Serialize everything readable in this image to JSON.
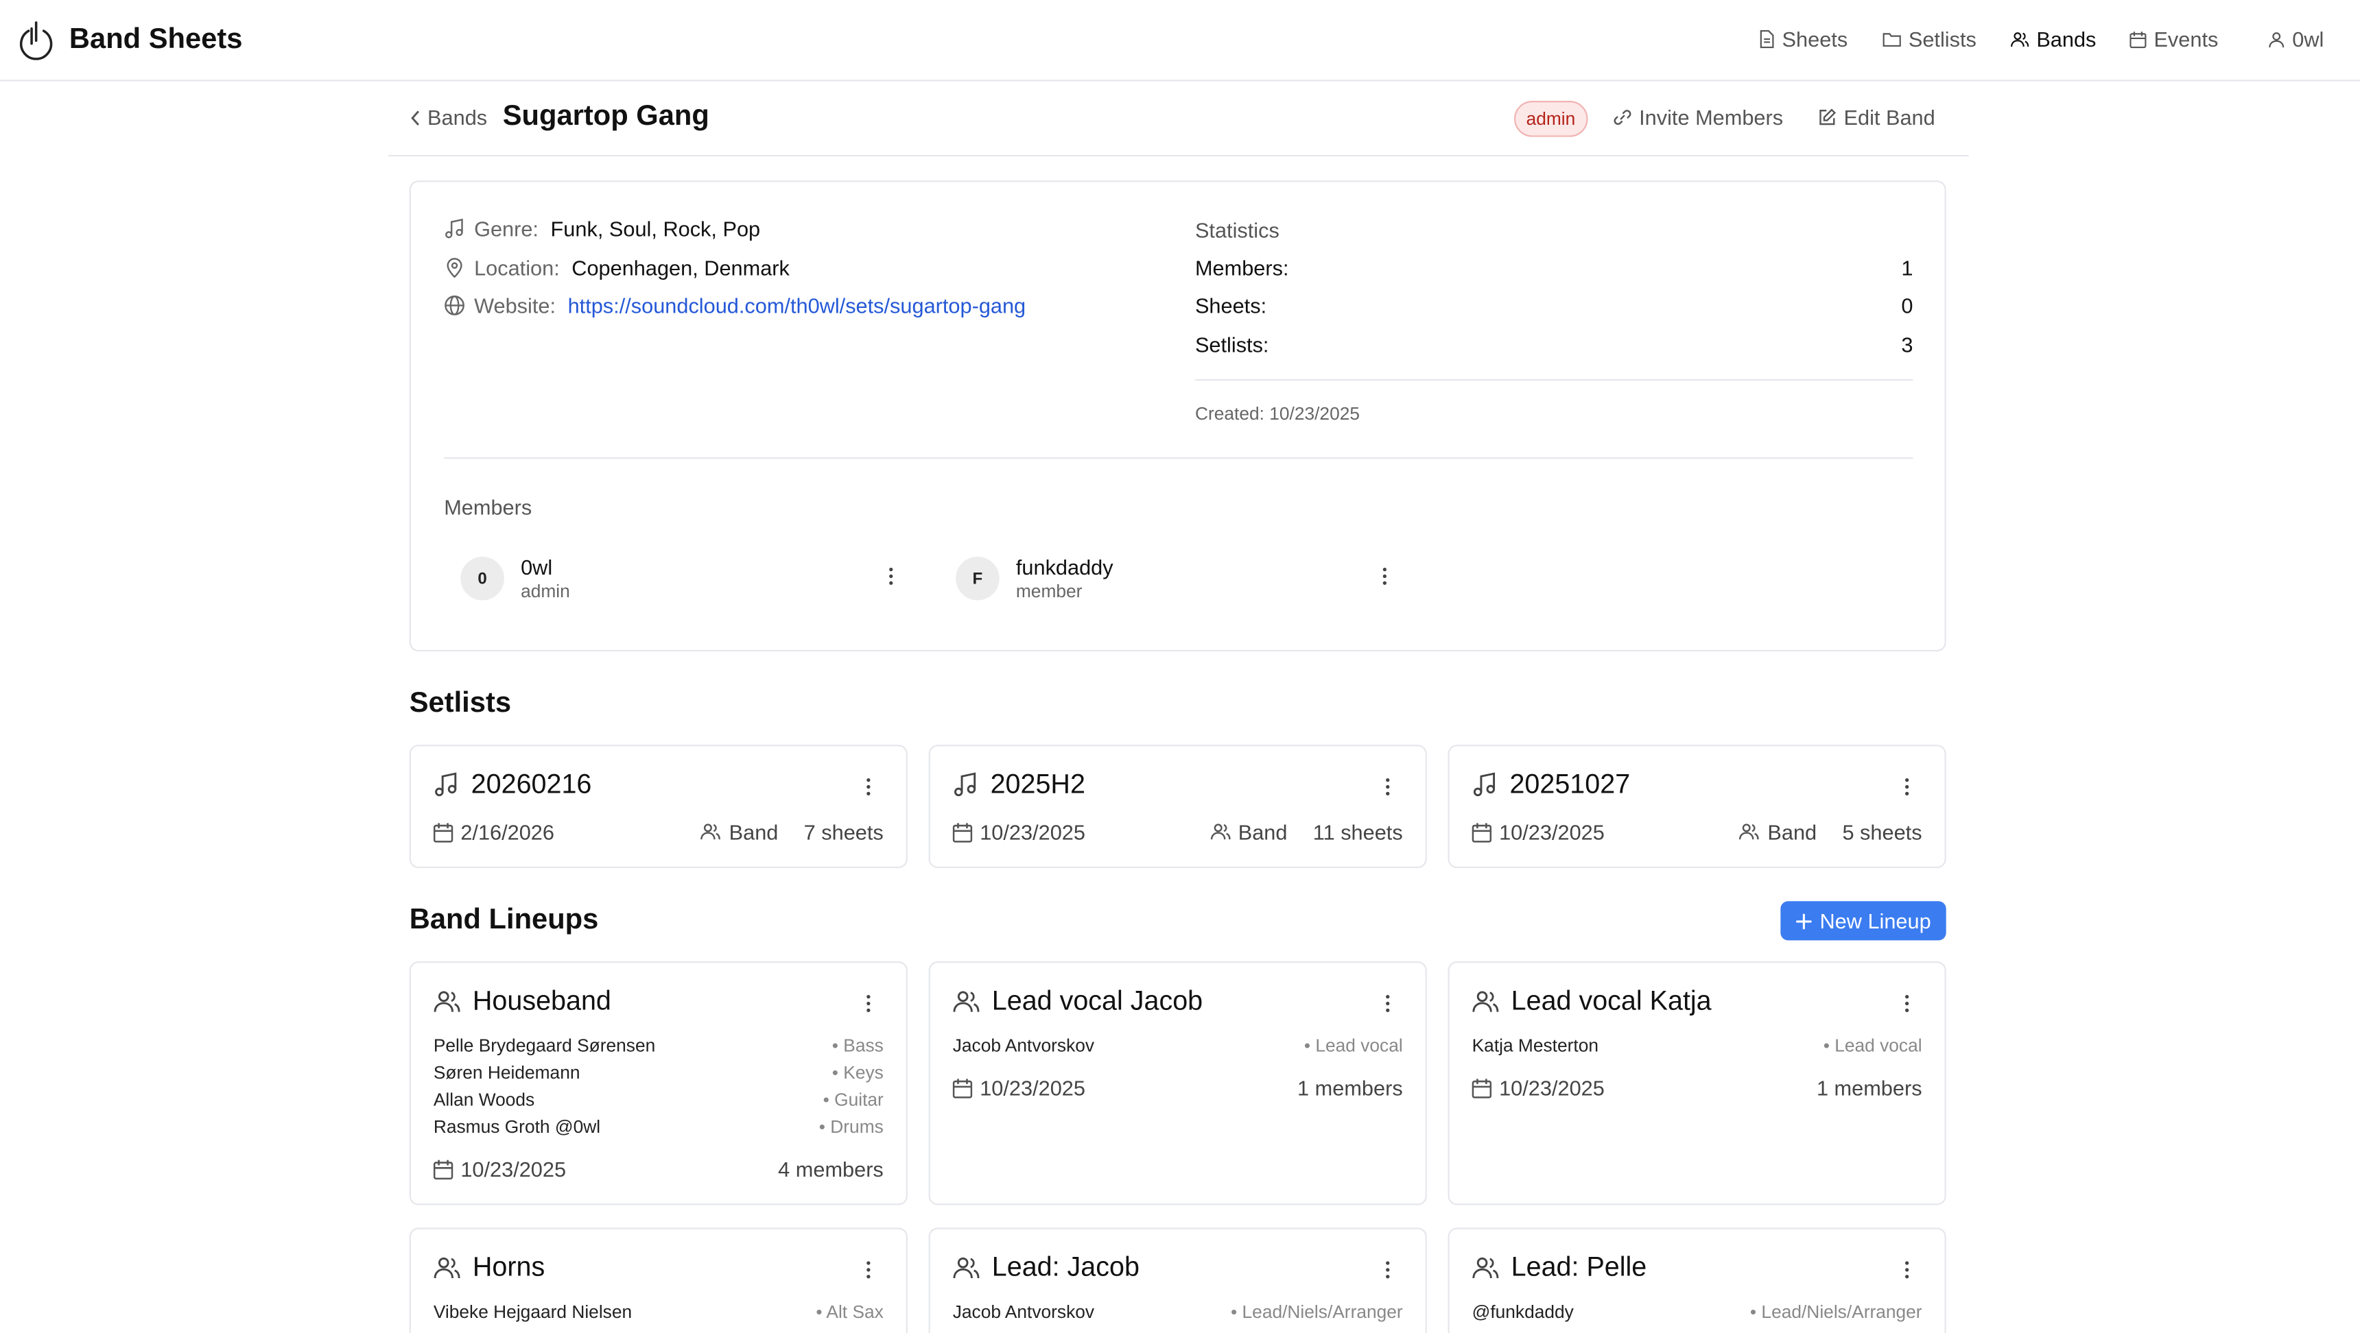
{
  "app": {
    "title": "Band Sheets"
  },
  "nav": {
    "sheets": "Sheets",
    "setlists": "Setlists",
    "bands": "Bands",
    "events": "Events",
    "user": "0wl"
  },
  "subheader": {
    "back_label": "Bands",
    "band_name": "Sugartop Gang",
    "role_badge": "admin",
    "invite_label": "Invite Members",
    "edit_label": "Edit Band"
  },
  "info": {
    "genre_label": "Genre:",
    "genre": "Funk, Soul, Rock, Pop",
    "location_label": "Location:",
    "location": "Copenhagen, Denmark",
    "website_label": "Website:",
    "website": "https://soundcloud.com/th0wl/sets/sugartop-gang"
  },
  "stats": {
    "title": "Statistics",
    "members_label": "Members:",
    "members": "1",
    "sheets_label": "Sheets:",
    "sheets": "0",
    "setlists_label": "Setlists:",
    "setlists": "3",
    "created": "Created: 10/23/2025"
  },
  "members": {
    "title": "Members",
    "items": [
      {
        "initial": "0",
        "name": "0wl",
        "role": "admin"
      },
      {
        "initial": "F",
        "name": "funkdaddy",
        "role": "member"
      }
    ]
  },
  "setlists": {
    "title": "Setlists",
    "items": [
      {
        "name": "20260216",
        "date": "2/16/2026",
        "scope": "Band",
        "count": "7 sheets"
      },
      {
        "name": "2025H2",
        "date": "10/23/2025",
        "scope": "Band",
        "count": "11 sheets"
      },
      {
        "name": "20251027",
        "date": "10/23/2025",
        "scope": "Band",
        "count": "5 sheets"
      }
    ]
  },
  "lineups": {
    "title": "Band Lineups",
    "new_label": "New Lineup",
    "items": [
      {
        "name": "Houseband",
        "members": [
          {
            "name": "Pelle Brydegaard Sørensen",
            "role": "• Bass"
          },
          {
            "name": "Søren Heidemann",
            "role": "• Keys"
          },
          {
            "name": "Allan Woods",
            "role": "• Guitar"
          },
          {
            "name": "Rasmus Groth @0wl",
            "role": "• Drums"
          }
        ],
        "date": "10/23/2025",
        "count": "4 members"
      },
      {
        "name": "Lead vocal Jacob",
        "members": [
          {
            "name": "Jacob Antvorskov",
            "role": "• Lead vocal"
          }
        ],
        "date": "10/23/2025",
        "count": "1 members"
      },
      {
        "name": "Lead vocal Katja",
        "members": [
          {
            "name": "Katja Mesterton",
            "role": "• Lead vocal"
          }
        ],
        "date": "10/23/2025",
        "count": "1 members"
      },
      {
        "name": "Horns",
        "members": [
          {
            "name": "Vibeke Hejgaard Nielsen",
            "role": "• Alt Sax"
          }
        ]
      },
      {
        "name": "Lead: Jacob",
        "members": [
          {
            "name": "Jacob Antvorskov",
            "role": "• Lead/Niels/Arranger"
          }
        ]
      },
      {
        "name": "Lead: Pelle",
        "members": [
          {
            "name": "@funkdaddy",
            "role": "• Lead/Niels/Arranger"
          }
        ]
      }
    ]
  }
}
